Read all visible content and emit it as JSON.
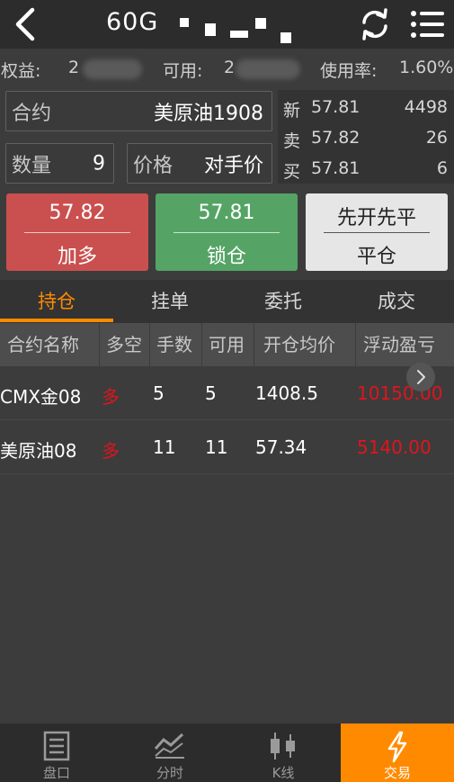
{
  "header": {
    "title": "60G"
  },
  "account": {
    "equity_label": "权益:",
    "equity_value": "2",
    "available_label": "可用:",
    "available_value": "2",
    "usage_label": "使用率:",
    "usage_value": "1.60%"
  },
  "order_form": {
    "contract_label": "合约",
    "contract_value": "美原油1908",
    "quantity_label": "数量",
    "quantity_value": "9",
    "price_label": "价格",
    "price_value": "对手价"
  },
  "quote": {
    "rows": [
      {
        "label": "新",
        "price": "57.81",
        "volume": "4498"
      },
      {
        "label": "卖",
        "price": "57.82",
        "volume": "26"
      },
      {
        "label": "买",
        "price": "57.81",
        "volume": "6"
      }
    ]
  },
  "actions": {
    "buy": {
      "price": "57.82",
      "label": "加多"
    },
    "lock": {
      "price": "57.81",
      "label": "锁仓"
    },
    "close": {
      "top": "先开先平",
      "label": "平仓"
    }
  },
  "tabs": [
    "持仓",
    "挂单",
    "委托",
    "成交"
  ],
  "table": {
    "headers": [
      "合约名称",
      "多空",
      "手数",
      "可用",
      "开仓均价",
      "浮动盈亏"
    ],
    "rows": [
      {
        "name": "CMX金08",
        "side": "多",
        "lots": "5",
        "available": "5",
        "avg_price": "1408.5",
        "pnl": "10150.00"
      },
      {
        "name": "美原油08",
        "side": "多",
        "lots": "11",
        "available": "11",
        "avg_price": "57.34",
        "pnl": "5140.00"
      }
    ]
  },
  "bottom_nav": [
    "盘口",
    "分时",
    "K线",
    "交易"
  ],
  "colors": {
    "accent": "#ff8a00",
    "buy_button": "#c9504f",
    "lock_button": "#55a466",
    "profit": "#e0141e"
  }
}
